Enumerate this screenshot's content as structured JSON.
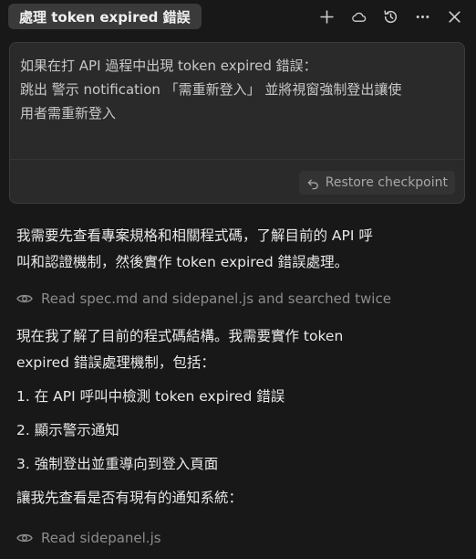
{
  "header": {
    "title": "處理 token expired 錯誤",
    "icons": [
      "plus-icon",
      "cloud-icon",
      "history-icon",
      "more-icon",
      "close-icon"
    ]
  },
  "prompt": {
    "line1": "如果在打 API 過程中出現 token expired 錯誤：",
    "line2": "跳出 警示 notification 「需重新登入」 並將視窗強制登出讓使",
    "line3": "用者需重新登入",
    "restore_label": "Restore checkpoint"
  },
  "messages": {
    "intro_line1": "我需要先查看專案規格和相關程式碼，了解目前的 API 呼",
    "intro_line2": "叫和認證機制，然後實作 token expired 錯誤處理。",
    "tool1": "Read spec.md and sidepanel.js and searched twice",
    "plan_line1": "現在我了解了目前的程式碼結構。我需要實作 token",
    "plan_line2": "expired 錯誤處理機制，包括：",
    "steps": [
      "1. 在 API 呼叫中檢測 token expired 錯誤",
      "2. 顯示警示通知",
      "3. 強制登出並重導向到登入頁面"
    ],
    "check": "讓我先查看是否有現有的通知系統：",
    "tool2": "Read sidepanel.js"
  },
  "colors": {
    "background": "#181818",
    "prompt_bg": "#2a2a2a",
    "muted_text": "#8c8c8c"
  }
}
